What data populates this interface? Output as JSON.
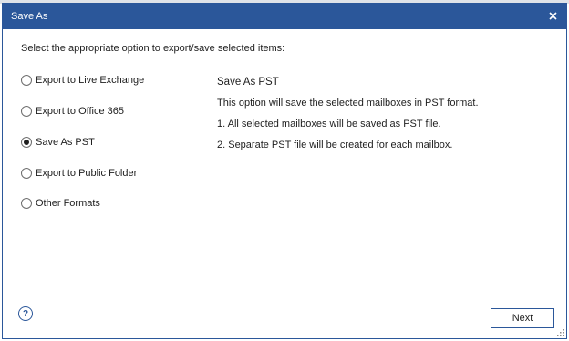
{
  "dialog": {
    "title": "Save As",
    "instruction": "Select the appropriate option to export/save selected items:",
    "options": [
      {
        "label": "Export to Live Exchange",
        "selected": false
      },
      {
        "label": "Export to Office 365",
        "selected": false
      },
      {
        "label": "Save As PST",
        "selected": true
      },
      {
        "label": "Export to Public Folder",
        "selected": false
      },
      {
        "label": "Other Formats",
        "selected": false
      }
    ],
    "description": {
      "title": "Save As PST",
      "lines": [
        "This option will save the selected mailboxes in PST format.",
        "1. All selected mailboxes will be saved as PST file.",
        "2. Separate PST file will be created for each mailbox."
      ]
    },
    "next_label": "Next"
  },
  "icons": {
    "close": "close-icon",
    "help": "help-icon",
    "resize": "resize-grip-icon"
  },
  "colors": {
    "titlebar": "#2b579a",
    "button_border": "#2b579a"
  }
}
